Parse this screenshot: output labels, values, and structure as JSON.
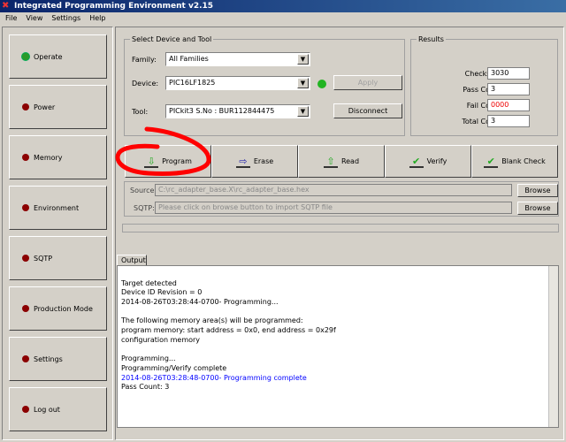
{
  "window": {
    "title": "Integrated Programming Environment v2.15"
  },
  "menu": [
    "File",
    "View",
    "Settings",
    "Help"
  ],
  "sidebar": [
    {
      "label": "Operate",
      "active": true
    },
    {
      "label": "Power"
    },
    {
      "label": "Memory"
    },
    {
      "label": "Environment"
    },
    {
      "label": "SQTP"
    },
    {
      "label": "Production Mode"
    },
    {
      "label": "Settings"
    },
    {
      "label": "Log out"
    }
  ],
  "device_group": {
    "title": "Select Device and Tool",
    "family_label": "Family:",
    "family": "All Families",
    "device_label": "Device:",
    "device": "PIC16LF1825",
    "tool_label": "Tool:",
    "tool": "PICkit3 S.No : BUR112844475",
    "apply": "Apply",
    "disconnect": "Disconnect",
    "status_color": "#22b422"
  },
  "results": {
    "title": "Results",
    "checksum_label": "Checksum:",
    "checksum": "3030",
    "pass_label": "Pass Count:",
    "pass": "3",
    "fail_label": "Fail Count:",
    "fail": "0000",
    "total_label": "Total Count:",
    "total": "3"
  },
  "actions": [
    "Program",
    "Erase",
    "Read",
    "Verify",
    "Blank Check"
  ],
  "source": {
    "label": "Source:",
    "value": "C:\\rc_adapter_base.X\\rc_adapter_base.hex",
    "browse": "Browse"
  },
  "sqtp": {
    "label": "SQTP:",
    "placeholder": "Please click on browse button to import SQTP file",
    "browse": "Browse"
  },
  "output": {
    "tab": "Output",
    "lines": [
      "",
      "Target detected",
      "Device ID Revision = 0",
      "2014-08-26T03:28:44-0700- Programming...",
      "",
      "The following memory area(s) will be programmed:",
      "program memory: start address = 0x0, end address = 0x29f",
      "configuration memory",
      "",
      "Programming...",
      "Programming/Verify complete",
      "2014-08-26T03:28:48-0700- Programming complete",
      "Pass Count: 3"
    ],
    "highlight_color": "#0000ff"
  }
}
